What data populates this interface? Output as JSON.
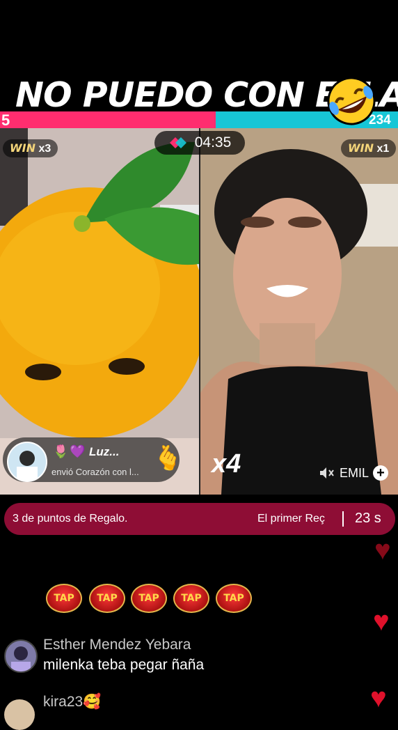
{
  "caption": {
    "text": "NO PUEDO CON ELLA",
    "emoji": "rolling-on-floor-laughing"
  },
  "battle": {
    "left_score": "5",
    "right_score": "234",
    "timer": "04:35",
    "left_win": {
      "label": "WIN",
      "count": "x3"
    },
    "right_win": {
      "label": "WIN",
      "count": "x1"
    },
    "multiplier": "x4",
    "right_host": "EMIL",
    "colors": {
      "left": "#ff2d6f",
      "right": "#17c6d6"
    }
  },
  "gift": {
    "sender": "Luz...",
    "description": "envió Corazón con l..."
  },
  "banner": {
    "left_text": "3 de puntos de Regalo.",
    "right_text": "El primer Reç",
    "time": "23 s"
  },
  "tap_buttons": [
    "TAP",
    "TAP",
    "TAP",
    "TAP",
    "TAP"
  ],
  "chat": [
    {
      "name": "Esther Mendez Yebara",
      "message": "milenka teba pegar ñaña"
    },
    {
      "name": "kira23",
      "message": ""
    }
  ]
}
